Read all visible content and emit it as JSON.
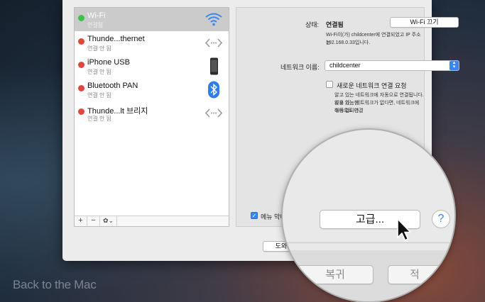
{
  "watermark": "Back to the Mac",
  "sidebar": {
    "items": [
      {
        "name": "Wi-Fi",
        "status": "연결됨",
        "icon": "wifi-icon",
        "dot": "#3bc24a"
      },
      {
        "name": "Thunde...thernet",
        "status": "연결 안 됨",
        "icon": "ethernet-arrows-icon",
        "dot": "#e0453e"
      },
      {
        "name": "iPhone USB",
        "status": "연결 안 됨",
        "icon": "iphone-icon",
        "dot": "#e0453e"
      },
      {
        "name": "Bluetooth PAN",
        "status": "연결 안 됨",
        "icon": "bluetooth-icon",
        "dot": "#e0453e"
      },
      {
        "name": "Thunde...lt 브리지",
        "status": "연결 안 됨",
        "icon": "bridge-arrows-icon",
        "dot": "#e0453e"
      }
    ],
    "add_label": "+",
    "remove_label": "−",
    "gear_label": "✿⌄"
  },
  "detail": {
    "status_label": "상태:",
    "status_value": "연결됨",
    "wifi_off_button": "Wi-Fi 끄기",
    "status_description_line1": "Wi-Fi이(가) childcenter에 연결되었고 IP 주소는",
    "status_description_line2": "192.168.0.33입니다.",
    "network_name_label": "네트워크 이름:",
    "network_name_value": "childcenter",
    "ask_join_label": "새로운 네트워크 연결 요청",
    "ask_join_desc_line1": "알고 있는 네트워크에 자동으로 연결됩니다. 사용 가능한",
    "ask_join_desc_line2": "알고 있는 네트워크가 없다면, 네트워크에 수동으로 연결",
    "ask_join_desc_line3": "해야 합니다.",
    "menu_bar_label": "메뉴 막대에서 Wi-Fi 상태 보기",
    "help_button_label": "도와주"
  },
  "magnifier": {
    "advanced_button": "고급...",
    "help_icon": "?",
    "revert_button": "복귀",
    "apply_button_partial": "적"
  },
  "colors": {
    "accent": "#3a86f0",
    "connected": "#3bc24a",
    "disconnected": "#e0453e"
  }
}
